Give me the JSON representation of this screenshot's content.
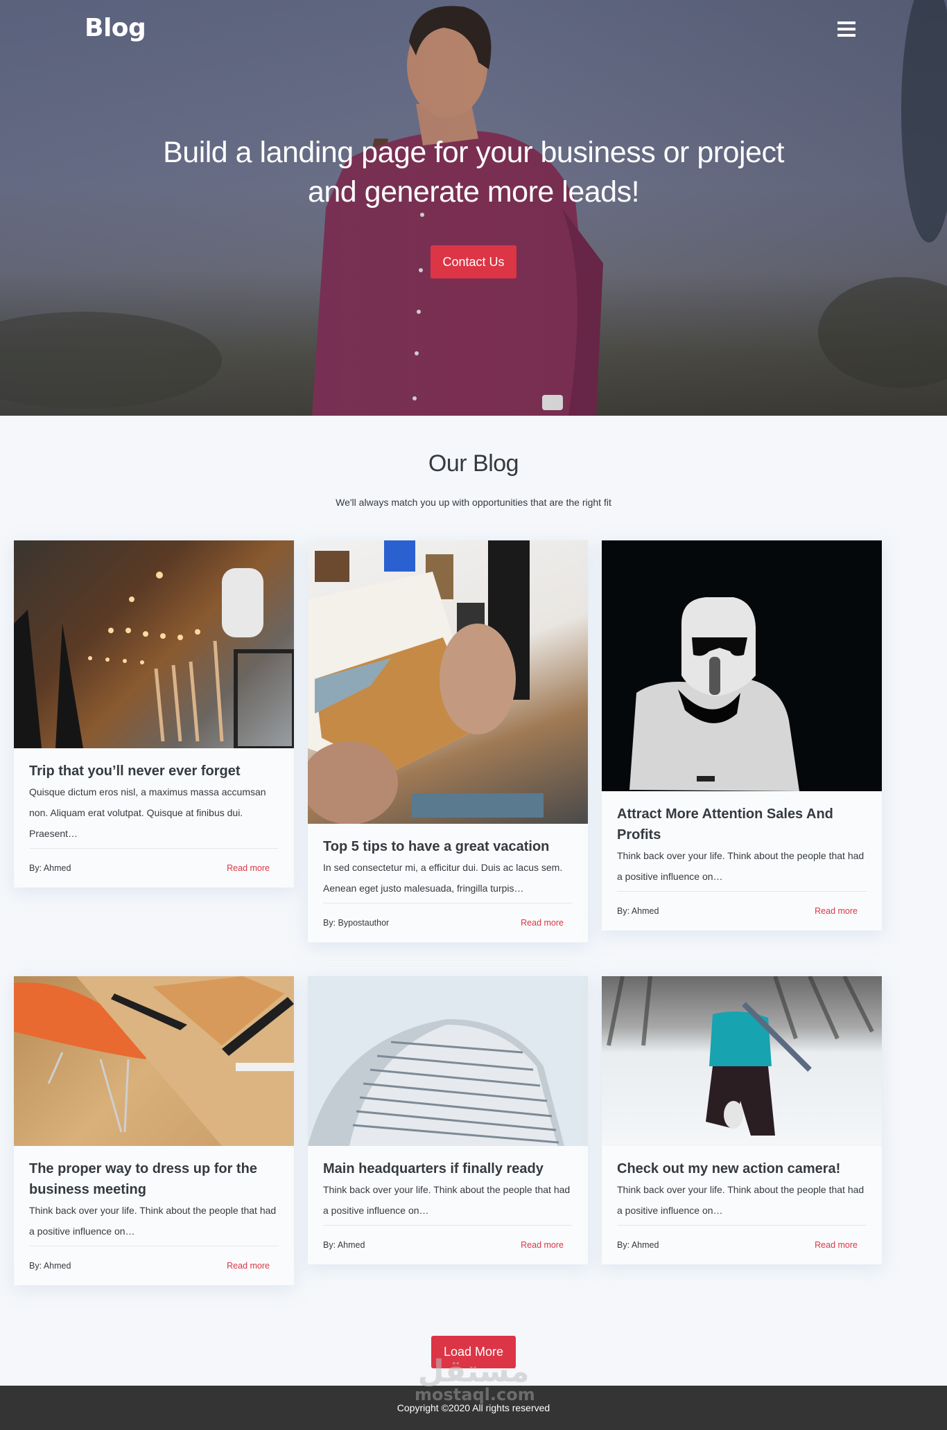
{
  "header": {
    "brand": "Blog",
    "menu_icon": "hamburger-menu-icon"
  },
  "hero": {
    "title": "Build a landing page for your business or project and generate more leads!",
    "cta_label": "Contact Us"
  },
  "blog_section": {
    "title": "Our Blog",
    "subtitle": "We'll always match you up with opportunities that are the right fit"
  },
  "posts": [
    {
      "image": "cafe-interior-photo",
      "title": "Trip that you’ll never ever forget",
      "excerpt": "Quisque dictum eros nisl, a maximus massa accumsan non. Aliquam erat volutpat. Quisque at finibus dui. Praesent…",
      "author": "By: Ahmed",
      "read_more": "Read more"
    },
    {
      "image": "hands-holding-photo",
      "title": "Top 5 tips to have a great vacation",
      "excerpt": "In sed consectetur mi, a efficitur dui. Duis ac lacus sem. Aenean eget justo malesuada, fringilla turpis…",
      "author": "By: Bypostauthor",
      "read_more": "Read more"
    },
    {
      "image": "stormtrooper-photo",
      "title": "Attract More Attention Sales And Profits",
      "excerpt": "Think back over your life. Think about the people that had a positive influence on…",
      "author": "By: Ahmed",
      "read_more": "Read more"
    },
    {
      "image": "desk-chair-photo",
      "title": "The proper way to dress up for the business meeting",
      "excerpt": "Think back over your life. Think about the people that had a positive influence on…",
      "author": "By: Ahmed",
      "read_more": "Read more"
    },
    {
      "image": "round-building-photo",
      "title": "Main headquarters if finally ready",
      "excerpt": "Think back over your life. Think about the people that had a positive influence on…",
      "author": "By: Ahmed",
      "read_more": "Read more"
    },
    {
      "image": "snow-hiker-photo",
      "title": "Check out my new action camera!",
      "excerpt": "Think back over your life. Think about the people that had a positive influence on…",
      "author": "By: Ahmed",
      "read_more": "Read more"
    }
  ],
  "load_more_label": "Load More",
  "footer": {
    "copyright": "Copyright ©2020 All rights reserved"
  },
  "watermark": {
    "mark": "مستقل",
    "text": "mostaql.com"
  },
  "colors": {
    "accent": "#dc3545",
    "page_bg": "#f5f7fa",
    "footer_bg": "#343434",
    "text": "#343a40"
  }
}
